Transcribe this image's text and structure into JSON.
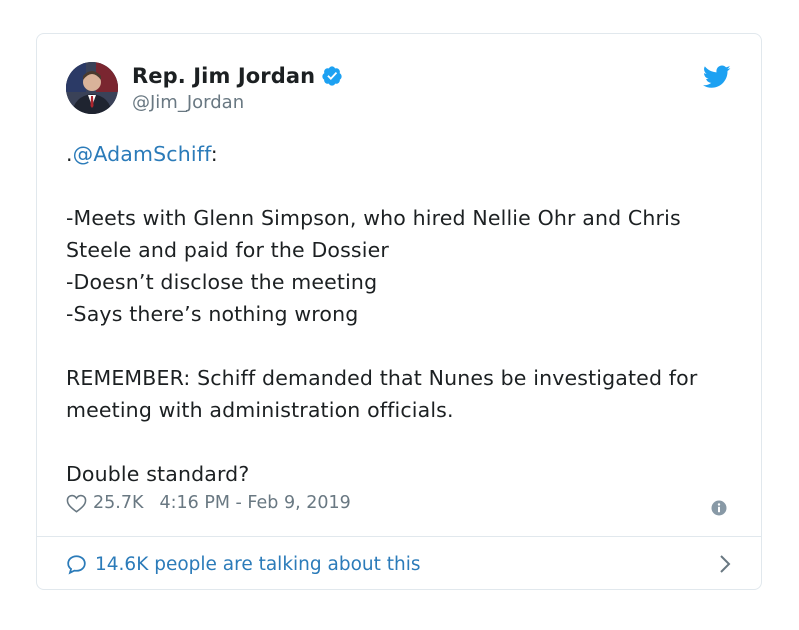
{
  "tweet": {
    "author": {
      "display_name": "Rep. Jim Jordan",
      "handle": "@Jim_Jordan",
      "verified": true
    },
    "mention": "@AdamSchiff",
    "mention_prefix": ".",
    "mention_suffix": ":",
    "lines": {
      "b1": "-Meets with Glenn Simpson, who hired Nellie Ohr and Chris Steele and paid for the Dossier",
      "b2": "-Doesn’t disclose the meeting",
      "b3": "-Says there’s nothing wrong",
      "remember": "REMEMBER: Schiff demanded that Nunes be investigated for meeting with administration officials.",
      "question": "Double standard?"
    },
    "likes": "25.7K",
    "timestamp": "4:16 PM - Feb 9, 2019",
    "talking": "14.6K people are talking about this"
  },
  "icons": {
    "bird": "twitter-bird-icon",
    "verified": "verified-badge-icon",
    "heart": "heart-icon",
    "info": "info-icon",
    "comment": "comment-bubble-icon",
    "chevron": "chevron-right-icon"
  },
  "colors": {
    "brand_blue": "#1da1f2",
    "link_blue": "#2b7bb9",
    "text": "#1c2022",
    "muted": "#697882",
    "border": "#e1e8ed"
  }
}
